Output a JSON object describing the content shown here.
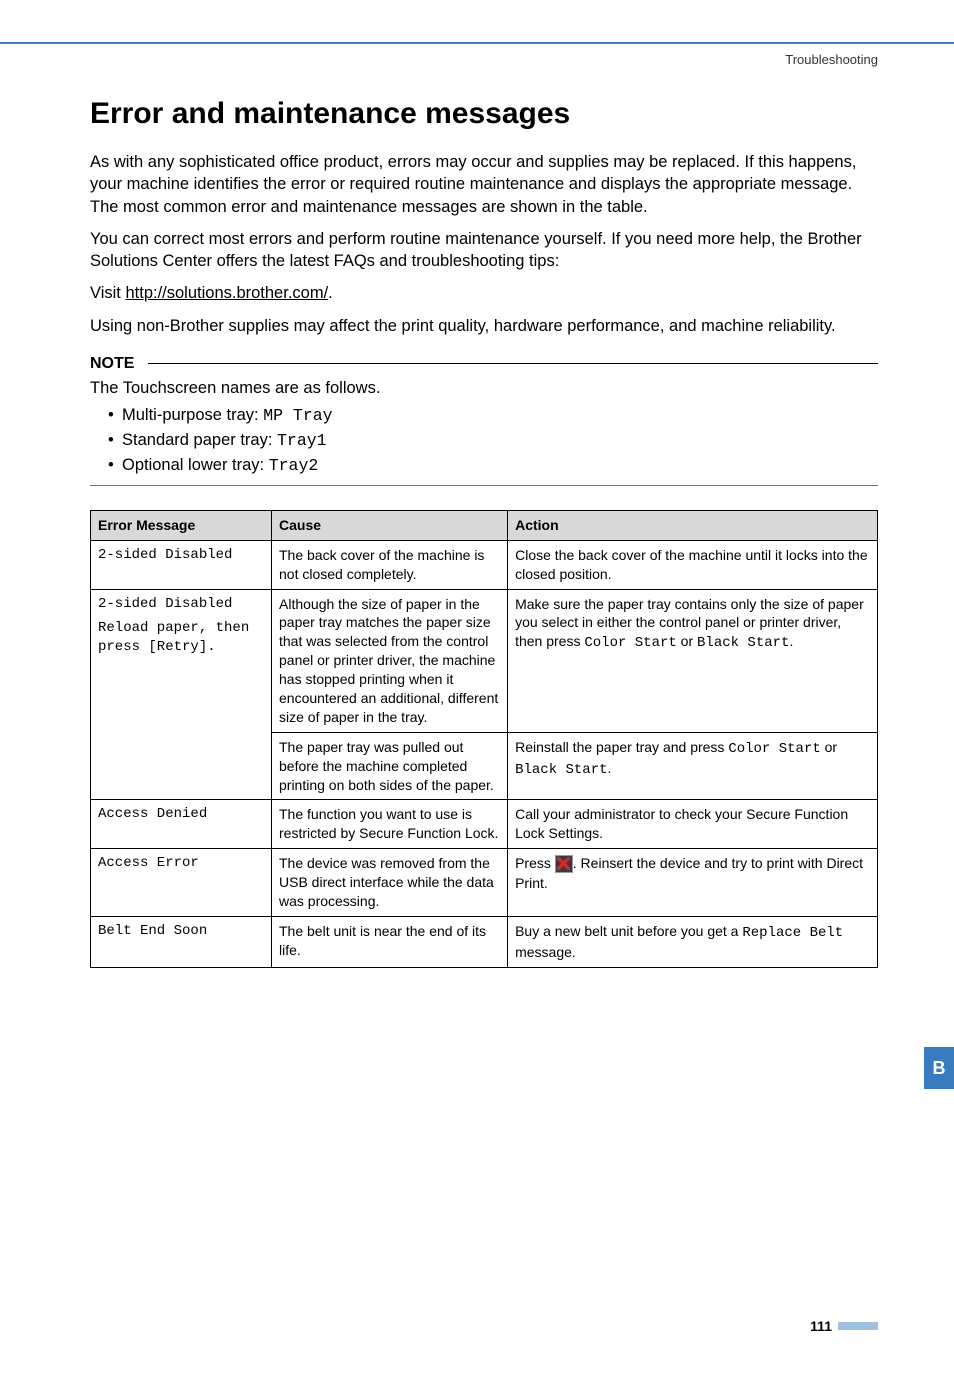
{
  "breadcrumb": "Troubleshooting",
  "heading": "Error and maintenance messages",
  "intro": {
    "p1": "As with any sophisticated office product, errors may occur and supplies may be replaced. If this happens, your machine identifies the error or required routine maintenance and displays the appropriate message. The most common error and maintenance messages are shown in the table.",
    "p2": "You can correct most errors and perform routine maintenance yourself. If you need more help, the Brother Solutions Center offers the latest FAQs and troubleshooting tips:",
    "visit_prefix": "Visit ",
    "visit_link": "http://solutions.brother.com/",
    "visit_suffix": ".",
    "p4": "Using non-Brother supplies may affect the print quality, hardware performance, and machine reliability."
  },
  "note": {
    "label": "NOTE",
    "body": "The Touchscreen names are as follows.",
    "items": [
      {
        "label": "Multi-purpose tray: ",
        "code": "MP Tray"
      },
      {
        "label": "Standard paper tray: ",
        "code": "Tray1"
      },
      {
        "label": "Optional lower tray: ",
        "code": "Tray2"
      }
    ]
  },
  "table": {
    "headers": {
      "c1": "Error Message",
      "c2": "Cause",
      "c3": "Action"
    },
    "rows": {
      "r1": {
        "msg": "2-sided Disabled",
        "cause": "The back cover of the machine is not closed completely.",
        "action": "Close the back cover of the machine until it locks into the closed position."
      },
      "r2": {
        "msg_l1": "2-sided Disabled",
        "msg_l2": "Reload paper, then press [Retry].",
        "cause": "Although the size of paper in the paper tray matches the paper size that was selected from the control panel or printer driver, the machine has stopped printing when it encountered an additional, different size of paper in the tray.",
        "action_pre": "Make sure the paper tray contains only the size of paper you select in either the control panel or printer driver, then press ",
        "action_code1": "Color Start",
        "action_mid": " or ",
        "action_code2": "Black Start",
        "action_post": "."
      },
      "r3": {
        "cause": "The paper tray was pulled out before the machine completed printing on both sides of the paper.",
        "action_pre": "Reinstall the paper tray and press ",
        "action_code1": "Color Start",
        "action_mid": " or ",
        "action_code2": "Black Start",
        "action_post": "."
      },
      "r4": {
        "msg": "Access Denied",
        "cause": "The function you want to use is restricted by Secure Function Lock.",
        "action": "Call your administrator to check your Secure Function Lock Settings."
      },
      "r5": {
        "msg": "Access Error",
        "cause": "The device was removed from the USB direct interface while the data was processing.",
        "action_pre": "Press ",
        "action_post": ". Reinsert the device and try to print with Direct Print."
      },
      "r6": {
        "msg": "Belt End Soon",
        "cause": "The belt unit is near the end of its life.",
        "action_pre": "Buy a new belt unit before you get a ",
        "action_code": "Replace Belt",
        "action_post": " message."
      }
    }
  },
  "side_tab": "B",
  "page_number": "111"
}
